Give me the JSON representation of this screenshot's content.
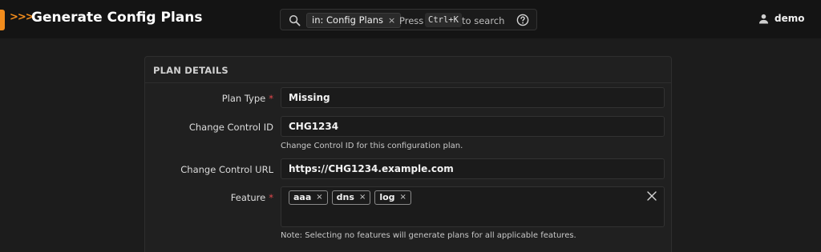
{
  "header": {
    "chevrons": ">>>",
    "title": "Generate Config Plans",
    "search": {
      "scope": "in: Config Plans",
      "scope_close": "×",
      "press": "Press",
      "shortcut": "Ctrl+K",
      "to_search": "to search"
    },
    "user": "demo"
  },
  "panel": {
    "title": "PLAN DETAILS",
    "fields": {
      "plan_type": {
        "label": "Plan Type",
        "required": "*",
        "value": "Missing"
      },
      "change_control_id": {
        "label": "Change Control ID",
        "value": "CHG1234",
        "help": "Change Control ID for this configuration plan."
      },
      "change_control_url": {
        "label": "Change Control URL",
        "value": "https://CHG1234.example.com"
      },
      "feature": {
        "label": "Feature",
        "required": "*",
        "tags": [
          "aaa",
          "dns",
          "log"
        ],
        "tag_remove": "×",
        "help": "Note: Selecting no features will generate plans for all applicable features."
      }
    }
  },
  "colors": {
    "accent": "#f28c1c",
    "required": "#e5484d",
    "background": "#1c1c1c",
    "topbar": "#141414"
  },
  "icons": [
    "menu-tab",
    "search-icon",
    "help-icon",
    "user-icon",
    "clear-icon"
  ]
}
